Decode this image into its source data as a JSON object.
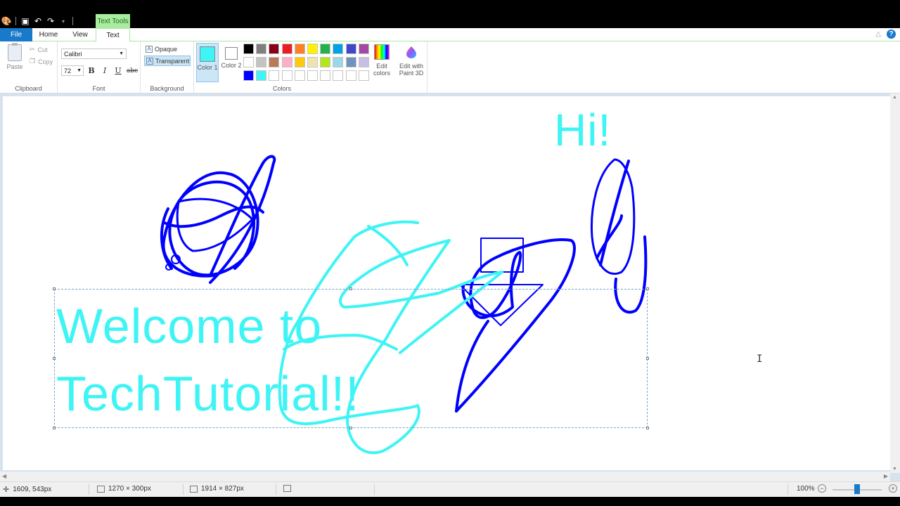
{
  "window": {
    "context_tab_header": "Text Tools"
  },
  "tabs": {
    "file": "File",
    "home": "Home",
    "view": "View",
    "text": "Text"
  },
  "ribbon": {
    "clipboard": {
      "label": "Clipboard",
      "paste": "Paste",
      "cut": "Cut",
      "copy": "Copy"
    },
    "font": {
      "label": "Font",
      "family": "Calibri",
      "size": "72",
      "bold": "B",
      "italic": "I",
      "underline": "U",
      "strikethrough": "abc"
    },
    "background": {
      "label": "Background",
      "opaque": "Opaque",
      "transparent": "Transparent",
      "selected": "Transparent"
    },
    "colors": {
      "label": "Colors",
      "color1_label": "Color 1",
      "color2_label": "Color 2",
      "color1": "#3ef4f5",
      "color2": "#ffffff",
      "edit_colors": "Edit colors",
      "edit_paint3d": "Edit with Paint 3D",
      "palette": [
        [
          "#000000",
          "#7f7f7f",
          "#880015",
          "#ed1c24",
          "#ff7f27",
          "#fff200",
          "#22b14c",
          "#00a2e8",
          "#3f48cc",
          "#a349a4"
        ],
        [
          "#ffffff",
          "#c3c3c3",
          "#b97a57",
          "#ffaec9",
          "#ffc90e",
          "#efe4b0",
          "#b5e61d",
          "#99d9ea",
          "#7092be",
          "#c8bfe7"
        ],
        [
          "#0000ff",
          "#3ef4f5",
          "#ffffff",
          "#ffffff",
          "#ffffff",
          "#ffffff",
          "#ffffff",
          "#ffffff",
          "#ffffff",
          "#ffffff"
        ]
      ]
    }
  },
  "canvas": {
    "text_hi": "Hi!",
    "text_welcome": "Welcome to",
    "text_tech": "TechTutorial!!",
    "text_color": "#3ef4f5",
    "stroke_color": "#0000ff"
  },
  "status": {
    "cursor_pos": "1609, 543px",
    "selection_size": "1270 × 300px",
    "image_size": "1914 × 827px",
    "zoom": "100%"
  }
}
